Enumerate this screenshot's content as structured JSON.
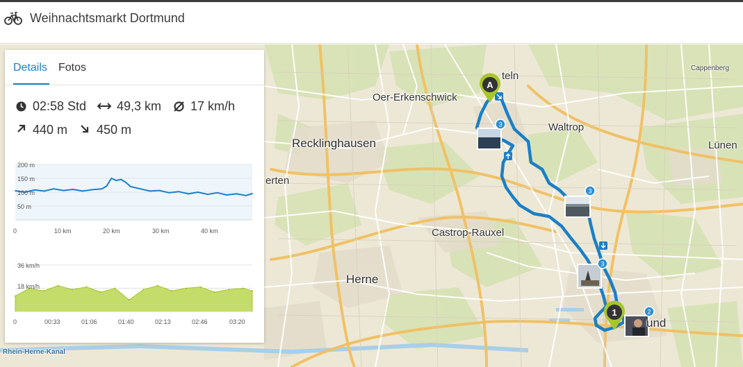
{
  "header": {
    "title": "Weihnachtsmarkt Dortmund",
    "icon": "bicycle-icon"
  },
  "tabs": [
    {
      "label": "Details",
      "active": true
    },
    {
      "label": "Fotos",
      "active": false
    }
  ],
  "stats": {
    "duration": "02:58 Std",
    "distance": "49,3 km",
    "avg_speed": "17 km/h",
    "ascent": "440 m",
    "descent": "450 m"
  },
  "elevation_chart": {
    "y_ticks": [
      "200 m",
      "150 m",
      "100 m",
      "50 m"
    ],
    "x_ticks": [
      "0",
      "10 km",
      "20 km",
      "30 km",
      "40 km"
    ]
  },
  "speed_chart": {
    "y_ticks": [
      "36 km/h",
      "18 km/h"
    ],
    "x_ticks": [
      "0",
      "00:33",
      "01:06",
      "01:40",
      "02:13",
      "02:46",
      "03:20"
    ]
  },
  "chart_data": [
    {
      "type": "line",
      "ylabel": "",
      "ylim": [
        0,
        200
      ],
      "xlim": [
        0,
        49.3
      ],
      "x": [
        0,
        2,
        4,
        6,
        8,
        10,
        12,
        14,
        16,
        18,
        19,
        20,
        21,
        22,
        23,
        24,
        26,
        28,
        30,
        32,
        34,
        36,
        38,
        40,
        42,
        44,
        46,
        48,
        49.3
      ],
      "y": [
        105,
        100,
        108,
        104,
        112,
        106,
        110,
        104,
        109,
        112,
        122,
        150,
        142,
        146,
        135,
        120,
        112,
        104,
        106,
        98,
        102,
        94,
        100,
        92,
        98,
        90,
        94,
        88,
        95
      ]
    },
    {
      "type": "area",
      "ylabel": "",
      "ylim": [
        0,
        36
      ],
      "xlim": [
        0,
        3.33
      ],
      "x": [
        0,
        0.2,
        0.4,
        0.6,
        0.8,
        1.0,
        1.2,
        1.4,
        1.6,
        1.8,
        2.0,
        2.2,
        2.4,
        2.6,
        2.8,
        3.0,
        3.2,
        3.33
      ],
      "y": [
        12,
        18,
        16,
        20,
        17,
        19,
        15,
        18,
        9,
        17,
        20,
        16,
        18,
        19,
        15,
        17,
        18,
        16
      ]
    }
  ],
  "map": {
    "places": [
      "Oer-Erkenschwick",
      "Recklinghausen",
      "Waltrop",
      "Castrop-Rauxel",
      "Herne",
      "Lünen",
      "Cappenberg",
      "Rhein-Herne-Kanal",
      "erten",
      "teln",
      "und"
    ],
    "markers": {
      "start": "A",
      "end": "1"
    },
    "photo_badges": [
      "3",
      "3",
      "3",
      "2"
    ],
    "route_color": "#1a7fc7"
  }
}
